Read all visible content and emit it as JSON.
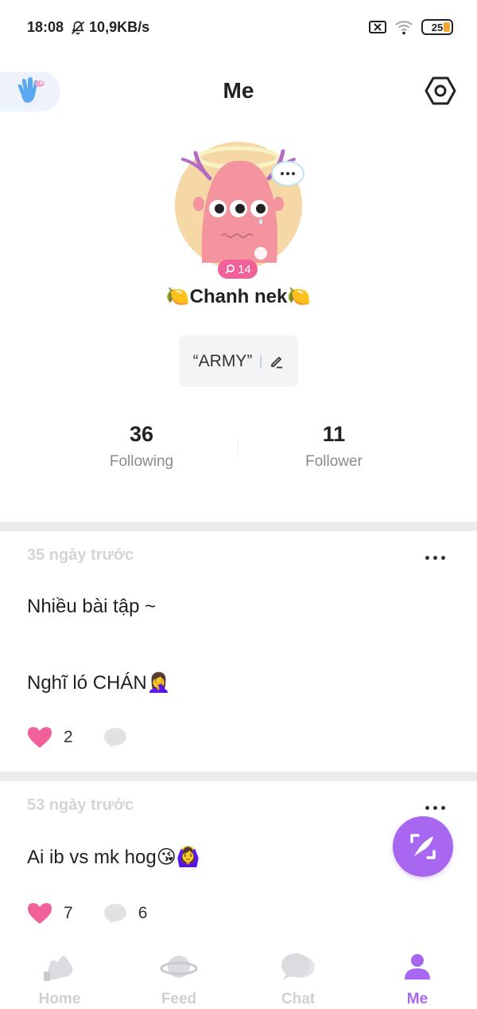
{
  "status_bar": {
    "time": "18:08",
    "net_speed": "10,9KB/s",
    "battery": "25"
  },
  "header": {
    "title": "Me"
  },
  "profile": {
    "level": "14",
    "username": "🍋Chanh nek🍋",
    "bio": "“ARMY”"
  },
  "stats": {
    "following_count": "36",
    "following_label": "Following",
    "follower_count": "11",
    "follower_label": "Follower"
  },
  "posts": [
    {
      "time": "35 ngày trước",
      "lines": [
        "Nhiều bài tập ~",
        "Nghĩ ló CHÁN🤦‍♀️"
      ],
      "likes": "2",
      "comments": ""
    },
    {
      "time": "53 ngày trước",
      "lines": [
        "Ai ib vs mk hog😘🙆‍♀️"
      ],
      "likes": "7",
      "comments": "6"
    }
  ],
  "tabs": [
    {
      "label": "Home"
    },
    {
      "label": "Feed"
    },
    {
      "label": "Chat"
    },
    {
      "label": "Me",
      "active": true
    }
  ],
  "colors": {
    "accent": "#a767f0",
    "like": "#f0619a",
    "muted": "#d0d0d4"
  }
}
